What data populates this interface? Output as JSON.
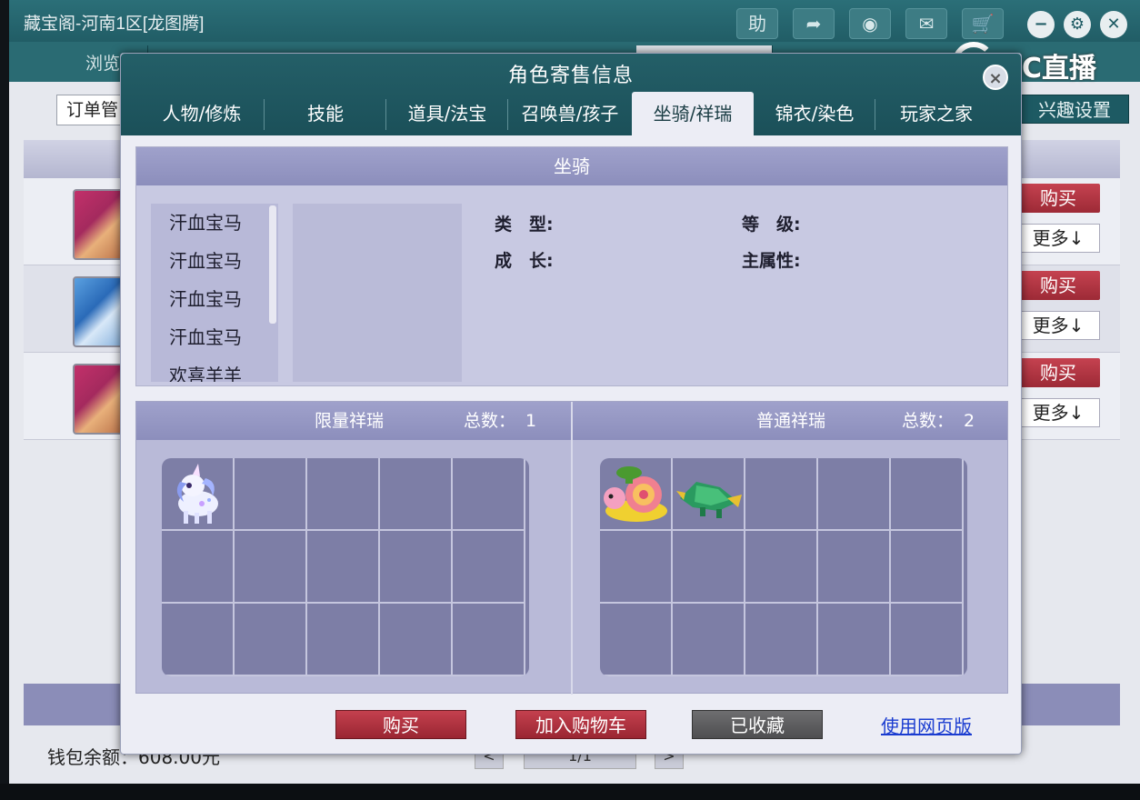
{
  "bg_window": {
    "title": "藏宝阁-河南1区[龙图腾]",
    "tool_help": "助",
    "tab_browse": "浏览",
    "order_label": "订单管",
    "interest_button": "兴趣设置",
    "rows": [
      {
        "buy": "购买",
        "more": "更多↓"
      },
      {
        "buy": "购买",
        "more": "更多↓"
      },
      {
        "buy": "购买",
        "more": "更多↓"
      }
    ],
    "wallet": "钱包余额：608.00元",
    "pager_text": "1/1"
  },
  "watermark": {
    "text": "CC直播"
  },
  "modal": {
    "title": "角色寄售信息",
    "close_glyph": "×",
    "tabs": [
      "人物/修炼",
      "技能",
      "道具/法宝",
      "召唤兽/孩子",
      "坐骑/祥瑞",
      "锦衣/染色",
      "玩家之家"
    ],
    "active_tab": "坐骑/祥瑞",
    "mount": {
      "heading": "坐骑",
      "list": [
        "汗血宝马",
        "汗血宝马",
        "汗血宝马",
        "汗血宝马",
        "欢喜羊羊"
      ],
      "type_label": "类　型:",
      "growth_label": "成　长:",
      "level_label": "等　级:",
      "main_attr_label": "主属性:"
    },
    "limited": {
      "heading": "限量祥瑞",
      "total_label": "总数：",
      "total": "1"
    },
    "normal": {
      "heading": "普通祥瑞",
      "total_label": "总数：",
      "total": "2"
    },
    "actions": {
      "buy": "购买",
      "add_cart": "加入购物车",
      "favorited": "已收藏",
      "web_version": "使用网页版"
    }
  },
  "colors": {
    "teal_header": "#1b5059",
    "panel_purple": "#8c8ebc",
    "grid_bg": "#7d7ea6",
    "buy_red": "#9a2632",
    "link_blue": "#1a3cd0"
  }
}
